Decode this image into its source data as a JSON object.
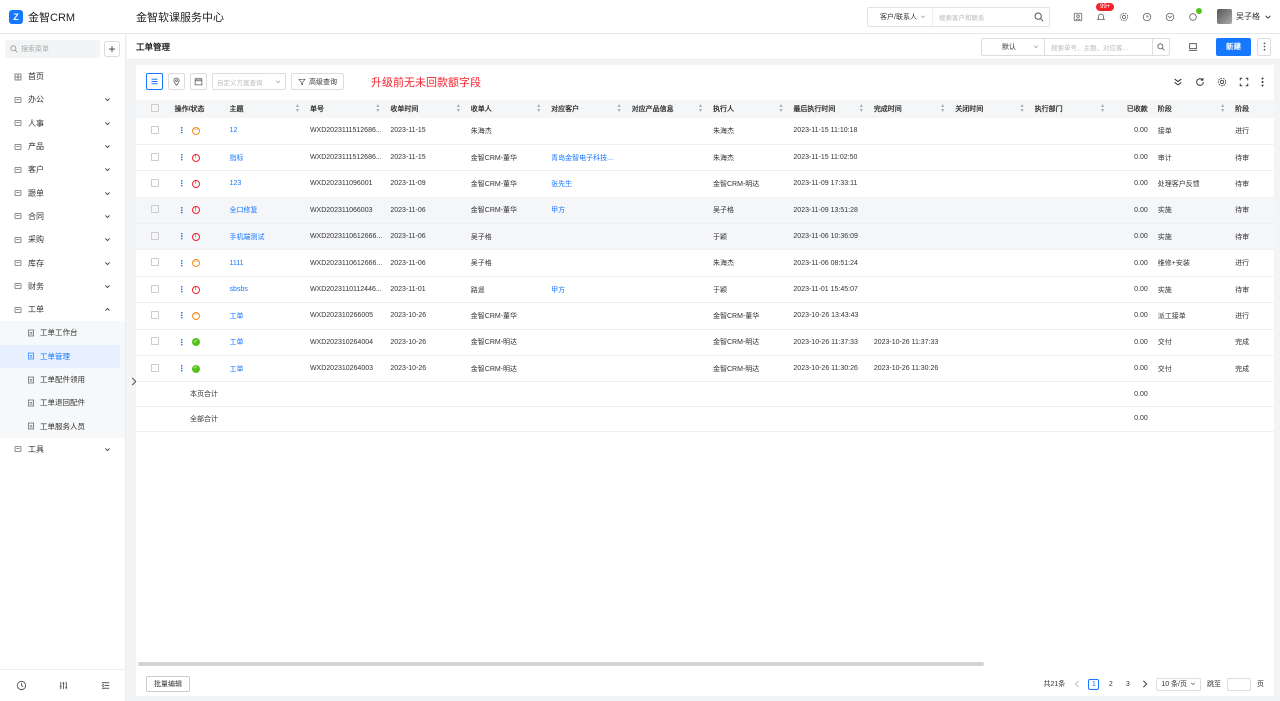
{
  "brand": {
    "name": "金智CRM",
    "logo_letter": "Z"
  },
  "app_title": "金智软课服务中心",
  "topbar": {
    "search_type": "客户/联系人",
    "search_placeholder": "搜索客户和联系",
    "notification_badge": "99+",
    "user_name": "吴子格"
  },
  "sidebar": {
    "search_placeholder": "搜索菜单",
    "menu": [
      {
        "label": "首页",
        "icon": "home-icon",
        "has_arrow": false
      },
      {
        "label": "办公",
        "icon": "briefcase-icon",
        "has_arrow": true
      },
      {
        "label": "人事",
        "icon": "person-icon",
        "has_arrow": true
      },
      {
        "label": "产品",
        "icon": "cube-icon",
        "has_arrow": true
      },
      {
        "label": "客户",
        "icon": "customer-icon",
        "has_arrow": true
      },
      {
        "label": "跟单",
        "icon": "target-icon",
        "has_arrow": true
      },
      {
        "label": "合同",
        "icon": "contract-icon",
        "has_arrow": true
      },
      {
        "label": "采购",
        "icon": "cart-icon",
        "has_arrow": true
      },
      {
        "label": "库存",
        "icon": "warehouse-icon",
        "has_arrow": true
      },
      {
        "label": "财务",
        "icon": "finance-icon",
        "has_arrow": true
      },
      {
        "label": "工单",
        "icon": "ticket-icon",
        "has_arrow": true,
        "expanded": true
      }
    ],
    "submenu": [
      {
        "label": "工单工作台",
        "active": false
      },
      {
        "label": "工单管理",
        "active": true
      },
      {
        "label": "工单配件领用",
        "active": false
      },
      {
        "label": "工单退回配件",
        "active": false
      },
      {
        "label": "工单服务人员",
        "active": false
      }
    ],
    "tools_label": "工具"
  },
  "page": {
    "title": "工单管理",
    "filter_default": "默认",
    "search_placeholder": "搜索单号、主题、对应客...",
    "new_button": "新建"
  },
  "toolbar": {
    "scheme_placeholder": "自定义方案查询",
    "advanced_query": "高级查询",
    "notice": "升级前无未回款额字段"
  },
  "table": {
    "columns": [
      "操作/状态",
      "主题",
      "单号",
      "收单时间",
      "收单人",
      "对应客户",
      "对应产品信息",
      "执行人",
      "最后执行时间",
      "完成时间",
      "关闭时间",
      "执行部门",
      "已收款",
      "阶段",
      "阶段"
    ],
    "rows": [
      {
        "status": "orange",
        "subject": "12",
        "number": "WXD2023111512686...",
        "date": "2023-11-15",
        "receiver": "朱海杰",
        "customer": "",
        "product": "",
        "executor": "朱海杰",
        "last_exec": "2023-11-15 11:10:18",
        "done": "",
        "closed": "",
        "dept": "",
        "received": "0.00",
        "stage": "接单",
        "stage2": "进行"
      },
      {
        "status": "red",
        "subject": "指标",
        "number": "WXD2023111512686...",
        "date": "2023-11-15",
        "receiver": "金智CRM-董华",
        "customer": "青岛金智电子科技...",
        "product": "",
        "executor": "朱海杰",
        "last_exec": "2023-11-15 11:02:50",
        "done": "",
        "closed": "",
        "dept": "",
        "received": "0.00",
        "stage": "审计",
        "stage2": "待审"
      },
      {
        "status": "red",
        "subject": "123",
        "number": "WXD202311096001",
        "date": "2023-11-09",
        "receiver": "金智CRM-董华",
        "customer": "张先生",
        "product": "",
        "executor": "金智CRM-明达",
        "last_exec": "2023-11-09 17:33:11",
        "done": "",
        "closed": "",
        "dept": "",
        "received": "0.00",
        "stage": "处理客户反馈",
        "stage2": "待审"
      },
      {
        "status": "red",
        "subject": "全口修复",
        "number": "WXD202311066003",
        "date": "2023-11-06",
        "receiver": "金智CRM-董华",
        "customer": "甲方",
        "product": "",
        "executor": "吴子格",
        "last_exec": "2023-11-09 13:51:28",
        "done": "",
        "closed": "",
        "dept": "",
        "received": "0.00",
        "stage": "实施",
        "stage2": "待审"
      },
      {
        "status": "red",
        "subject": "手机端测试",
        "number": "WXD2023110612666...",
        "date": "2023-11-06",
        "receiver": "吴子格",
        "customer": "",
        "product": "",
        "executor": "于颖",
        "last_exec": "2023-11-06 10:36:09",
        "done": "",
        "closed": "",
        "dept": "",
        "received": "0.00",
        "stage": "实施",
        "stage2": "待审"
      },
      {
        "status": "orange",
        "subject": "1111",
        "number": "WXD2023110612666...",
        "date": "2023-11-06",
        "receiver": "吴子格",
        "customer": "",
        "product": "",
        "executor": "朱海杰",
        "last_exec": "2023-11-06 08:51:24",
        "done": "",
        "closed": "",
        "dept": "",
        "received": "0.00",
        "stage": "维修+安装",
        "stage2": "进行"
      },
      {
        "status": "red",
        "subject": "sbsbs",
        "number": "WXD2023110112446...",
        "date": "2023-11-01",
        "receiver": "路遥",
        "customer": "甲方",
        "product": "",
        "executor": "于颖",
        "last_exec": "2023-11-01 15:45:07",
        "done": "",
        "closed": "",
        "dept": "",
        "received": "0.00",
        "stage": "实施",
        "stage2": "待审"
      },
      {
        "status": "orange",
        "subject": "工单",
        "number": "WXD202310266005",
        "date": "2023-10-26",
        "receiver": "金智CRM-董华",
        "customer": "",
        "product": "",
        "executor": "金智CRM-董华",
        "last_exec": "2023-10-26 13:43:43",
        "done": "",
        "closed": "",
        "dept": "",
        "received": "0.00",
        "stage": "派工接单",
        "stage2": "进行"
      },
      {
        "status": "green",
        "subject": "工单",
        "number": "WXD202310264004",
        "date": "2023-10-26",
        "receiver": "金智CRM-明达",
        "customer": "",
        "product": "",
        "executor": "金智CRM-明达",
        "last_exec": "2023-10-26 11:37:33",
        "done": "2023-10-26 11:37:33",
        "closed": "",
        "dept": "",
        "received": "0.00",
        "stage": "交付",
        "stage2": "完成"
      },
      {
        "status": "green",
        "subject": "工单",
        "number": "WXD202310264003",
        "date": "2023-10-26",
        "receiver": "金智CRM-明达",
        "customer": "",
        "product": "",
        "executor": "金智CRM-明达",
        "last_exec": "2023-10-26 11:30:26",
        "done": "2023-10-26 11:30:26",
        "closed": "",
        "dept": "",
        "received": "0.00",
        "stage": "交付",
        "stage2": "完成"
      }
    ],
    "page_total_label": "本页合计",
    "page_total_value": "0.00",
    "all_total_label": "全部合计",
    "all_total_value": "0.00"
  },
  "footer": {
    "bulk_edit": "批量编辑",
    "total": "共21条",
    "pages": [
      "1",
      "2",
      "3"
    ],
    "current_page": "1",
    "page_size": "10 条/页",
    "jump_label": "跳至",
    "page_unit": "页"
  },
  "colors": {
    "primary": "#1677ff",
    "notice": "#f5222d",
    "status_orange": "#fa8c16",
    "status_red": "#f5222d",
    "status_green": "#52c41a"
  }
}
